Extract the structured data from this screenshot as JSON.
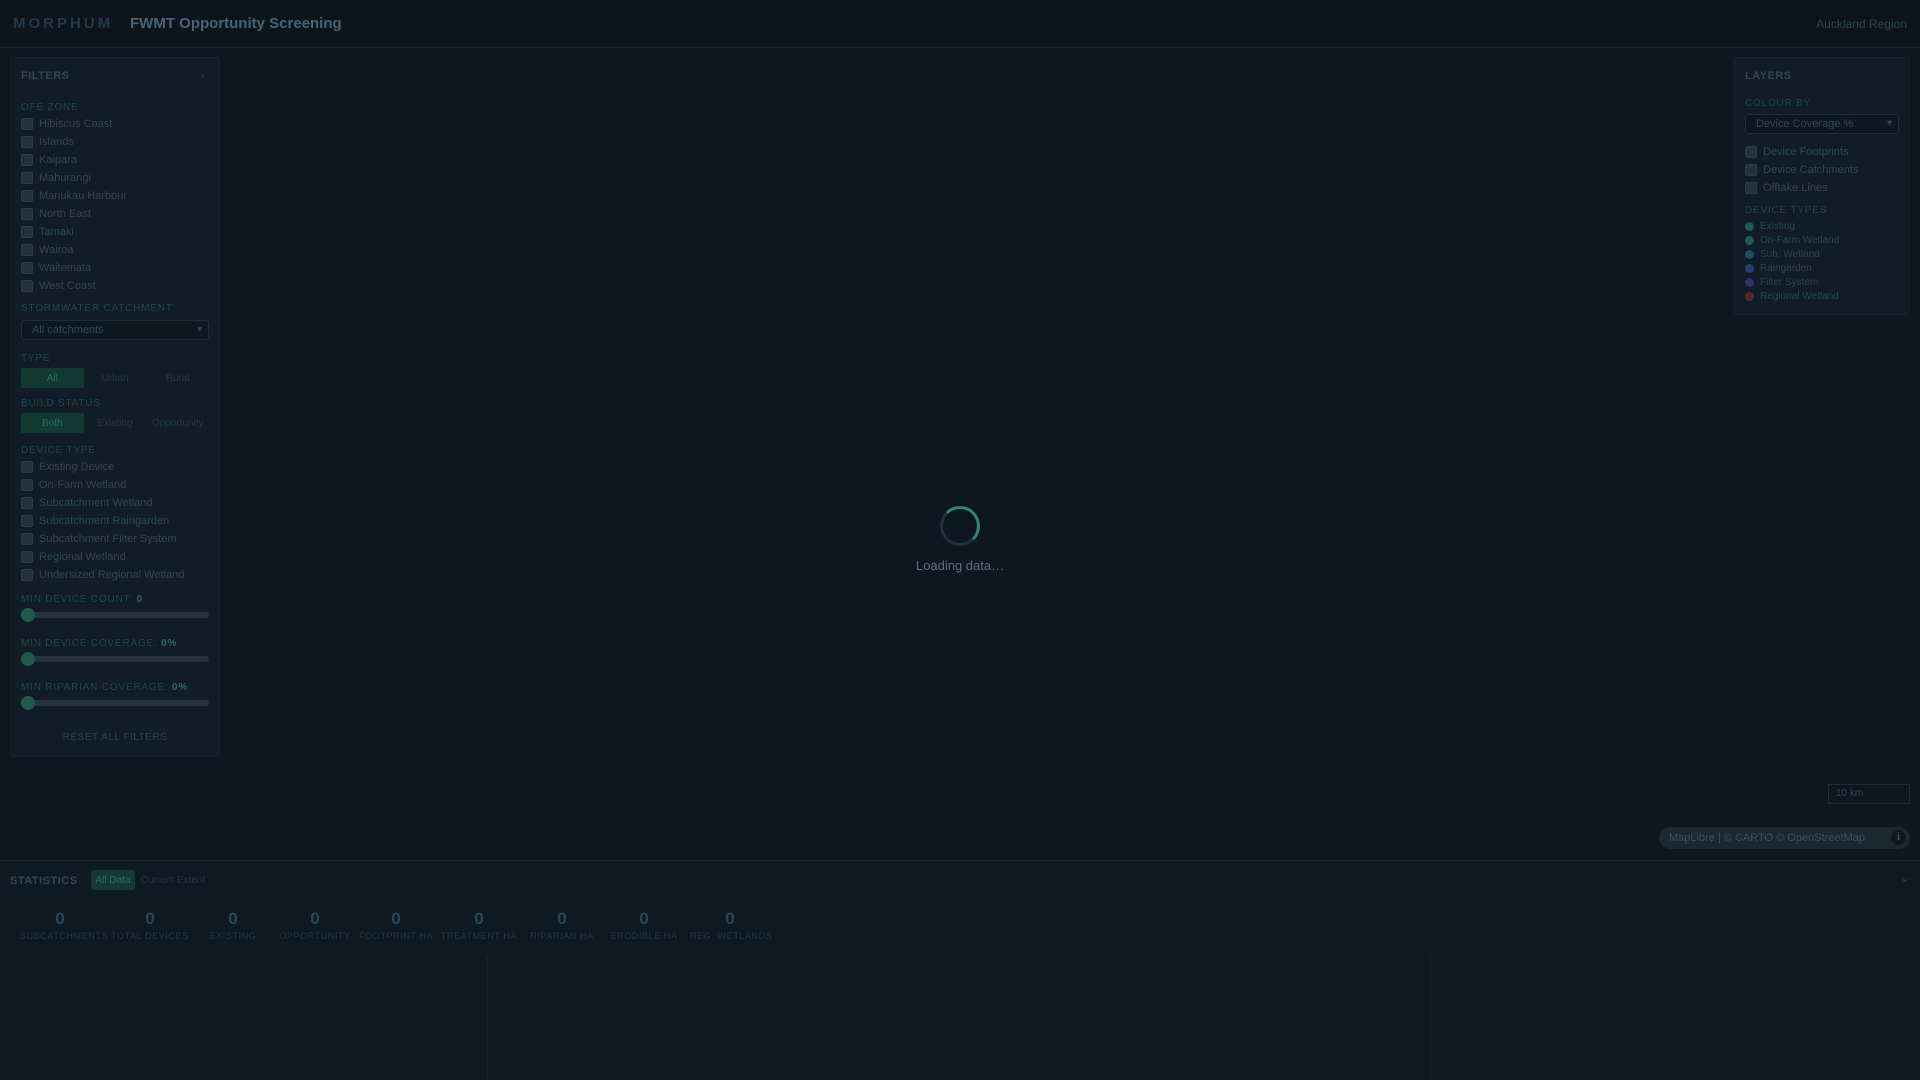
{
  "header": {
    "brand": "MORPHUM",
    "title": "FWMT Opportunity Screening",
    "region": "Auckland Region"
  },
  "filters": {
    "title": "FILTERS",
    "collapse_icon": "chevron-left-icon",
    "ofe_zone": {
      "label": "OFE ZONE",
      "items": [
        "Hibiscus Coast",
        "Islands",
        "Kaipara",
        "Mahurangi",
        "Manukau Harbour",
        "North East",
        "Tamaki",
        "Wairoa",
        "Waitemata",
        "West Coast"
      ]
    },
    "catchment": {
      "label": "STORMWATER CATCHMENT",
      "value": "All catchments"
    },
    "type": {
      "label": "TYPE",
      "options": [
        "All",
        "Urban",
        "Rural"
      ],
      "selected": "All"
    },
    "build_status": {
      "label": "BUILD STATUS",
      "options": [
        "Both",
        "Existing",
        "Opportunity"
      ],
      "selected": "Both"
    },
    "device_type": {
      "label": "DEVICE TYPE",
      "items": [
        "Existing Device",
        "On-Farm Wetland",
        "Subcatchment Wetland",
        "Subcatchment Raingarden",
        "Subcatchment Filter System",
        "Regional Wetland",
        "Undersized Regional Wetland"
      ]
    },
    "min_device_count": {
      "label": "MIN DEVICE COUNT:",
      "value": "0",
      "fraction": 0
    },
    "min_device_coverage": {
      "label": "MIN DEVICE COVERAGE:",
      "value": "0%",
      "fraction": 0
    },
    "min_riparian_coverage": {
      "label": "MIN RIPARIAN COVERAGE:",
      "value": "0%",
      "fraction": 0
    },
    "reset_label": "RESET ALL FILTERS"
  },
  "layers": {
    "title": "LAYERS",
    "colour_by": {
      "label": "COLOUR BY",
      "value": "Device Coverage %"
    },
    "toggles": [
      "Device Footprints",
      "Device Catchments",
      "Offtake Lines"
    ],
    "device_types": {
      "label": "DEVICE TYPES",
      "items": [
        {
          "name": "Existing",
          "color": "#1f5a4a"
        },
        {
          "name": "On-Farm Wetland",
          "color": "#1d5a5a"
        },
        {
          "name": "Sub. Wetland",
          "color": "#1f4a60"
        },
        {
          "name": "Raingarden",
          "color": "#24406a"
        },
        {
          "name": "Filter System",
          "color": "#33306a"
        },
        {
          "name": "Regional Wetland",
          "color": "#5a2430"
        }
      ]
    }
  },
  "map": {
    "scale": "10 km",
    "attribution": "MapLibre | © CARTO © OpenStreetMap",
    "info_icon": "info-icon",
    "loading_text": "Loading data…"
  },
  "stats": {
    "title": "STATISTICS",
    "tabs": [
      "All Data",
      "Current Extent"
    ],
    "selected_tab": "All Data",
    "toggle_icon": "chevron-down-icon",
    "items": [
      {
        "value": "0",
        "label": "SUBCATCHMENTS"
      },
      {
        "value": "0",
        "label": "TOTAL DEVICES"
      },
      {
        "value": "0",
        "label": "EXISTING"
      },
      {
        "value": "0",
        "label": "OPPORTUNITY"
      },
      {
        "value": "0",
        "label": "FOOTPRINT HA"
      },
      {
        "value": "0",
        "label": "TREATMENT HA"
      },
      {
        "value": "0",
        "label": "RIPARIAN HA"
      },
      {
        "value": "0",
        "label": "ERODIBLE HA"
      },
      {
        "value": "0",
        "label": "REG. WETLANDS"
      }
    ]
  }
}
